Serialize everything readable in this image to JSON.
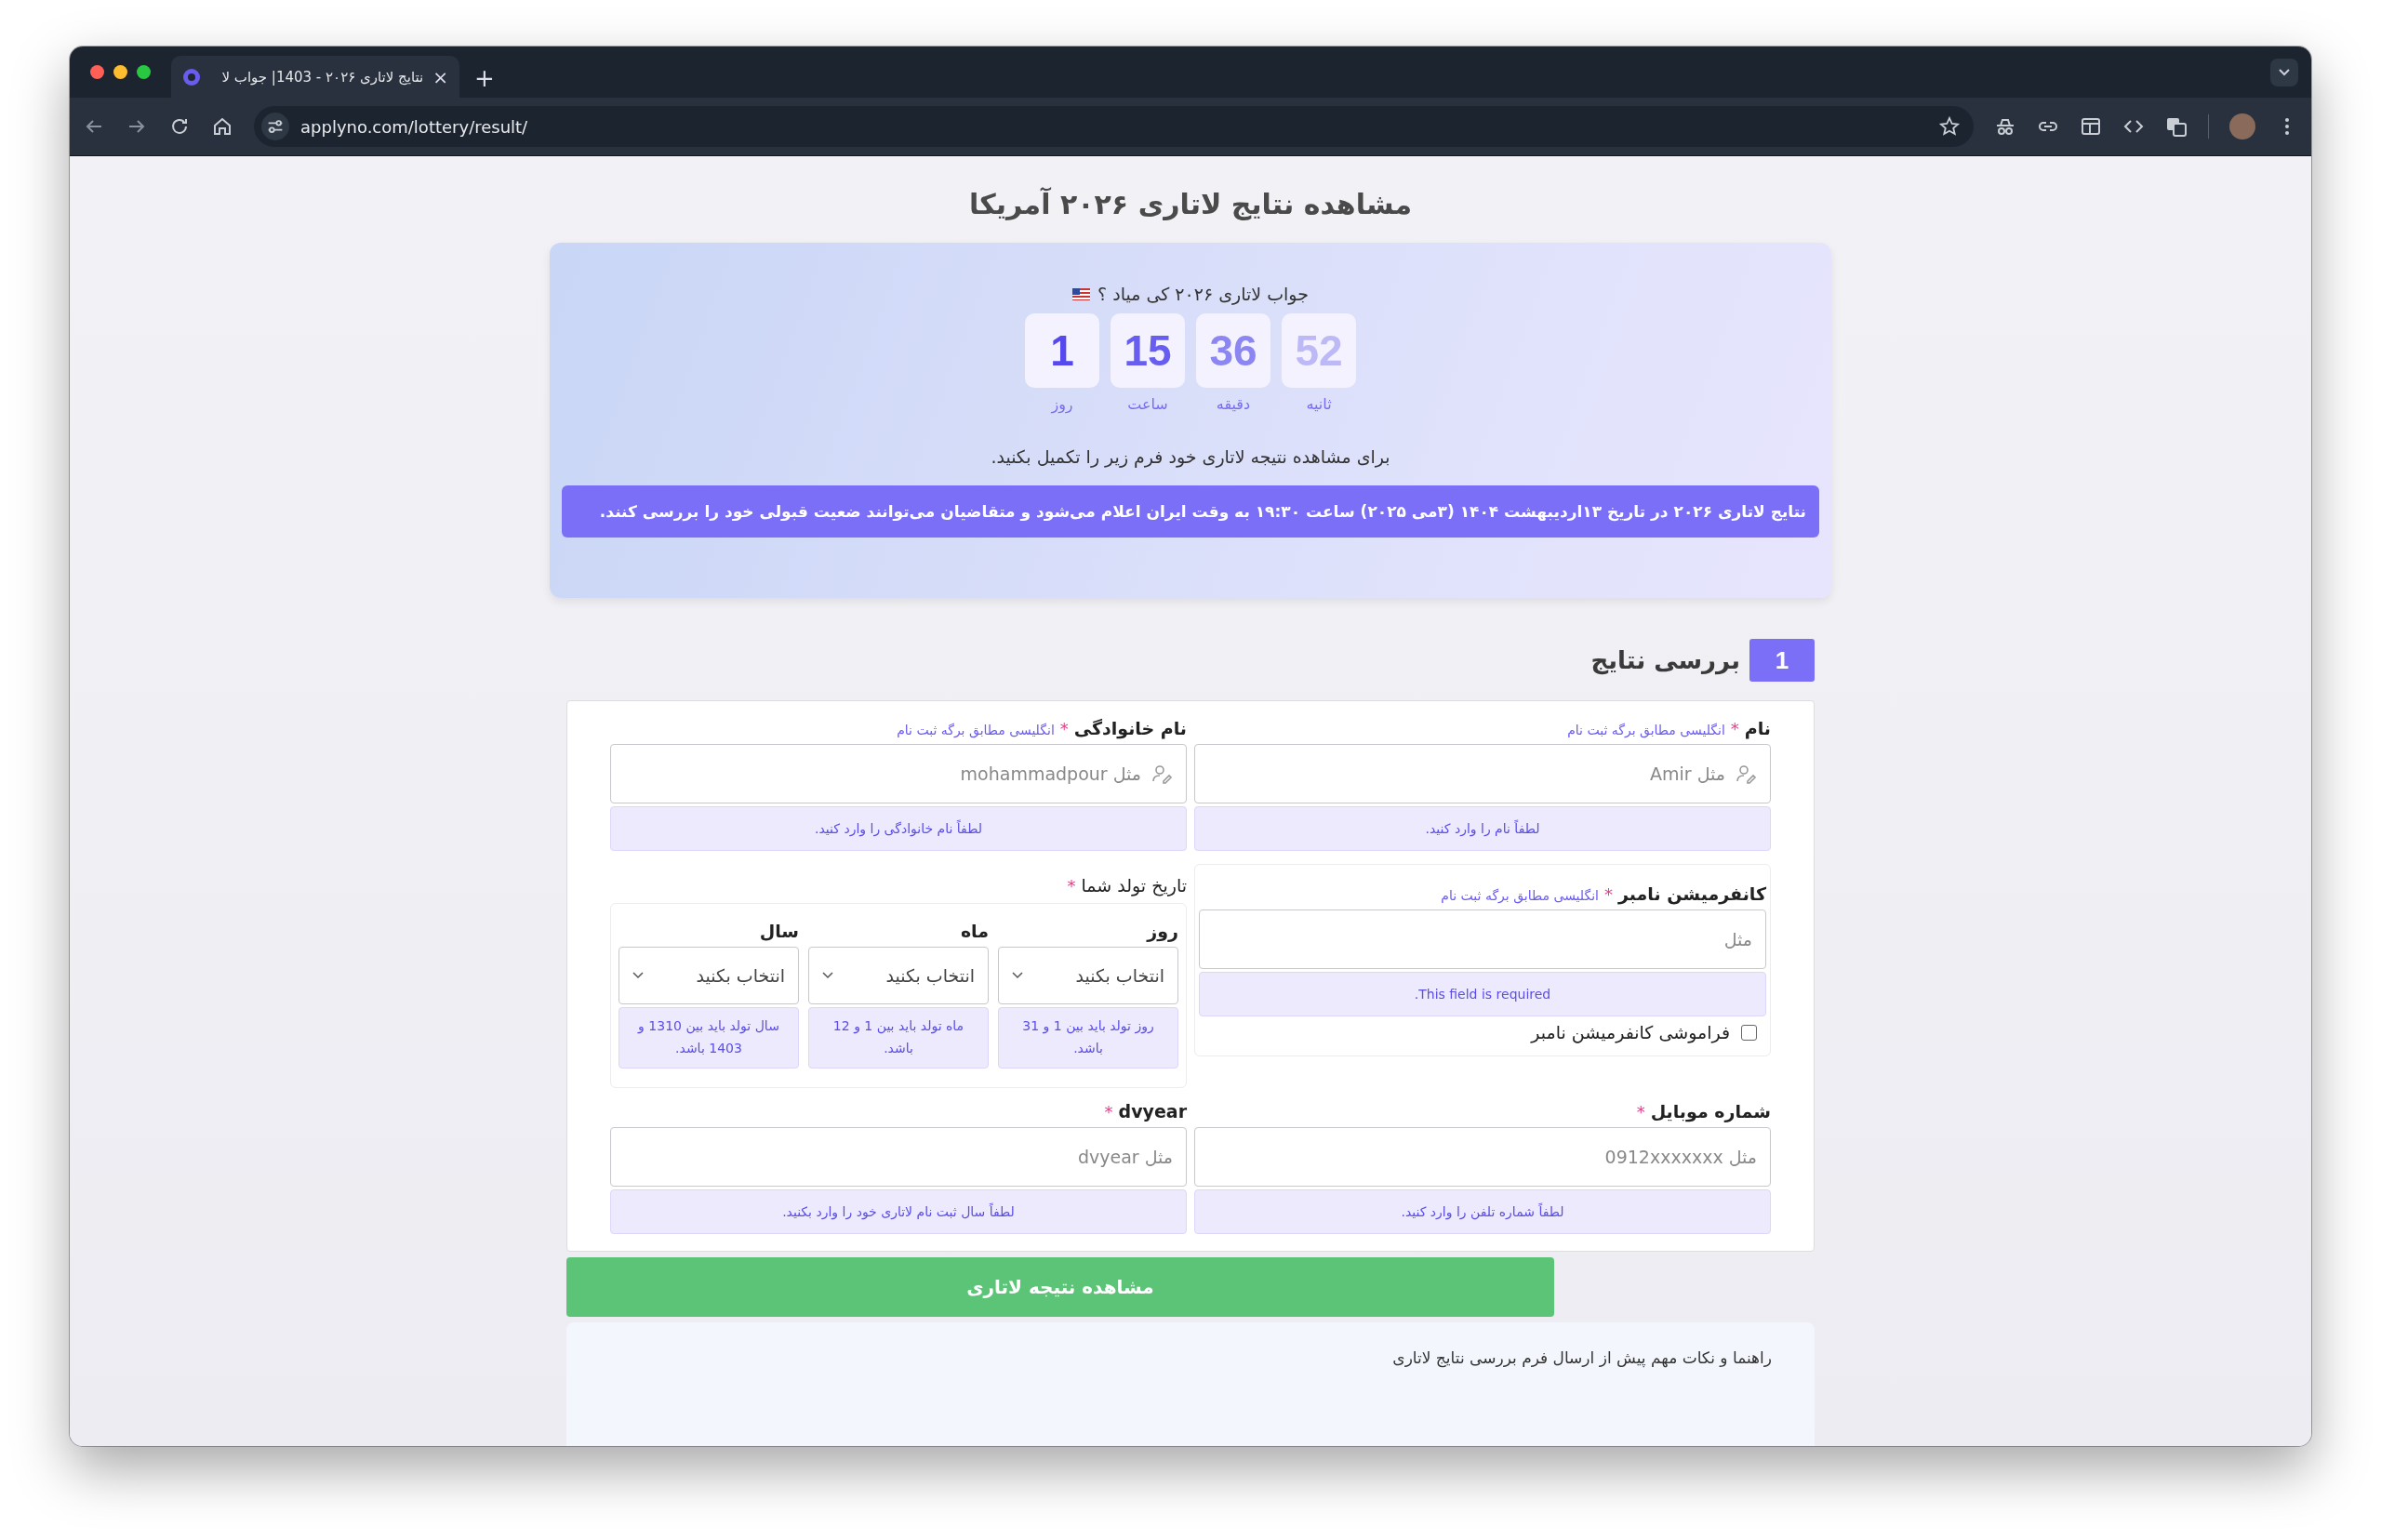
{
  "browser": {
    "tab_title": "نتایج لاتاری ۲۰۲۶ - 1403| جواب لا",
    "tab_close": "×",
    "new_tab": "+",
    "url": "applyno.com/lottery/result/"
  },
  "page": {
    "title": "مشاهده نتایج لاتاری ۲۰۲۶ آمریکا"
  },
  "countdown": {
    "question": "جواب لاتاری ۲۰۲۶ کی میاد ؟",
    "units": [
      {
        "value": "52",
        "label": "ثانیه",
        "color": "#bdb8f6"
      },
      {
        "value": "36",
        "label": "دقیقه",
        "color": "#8c86f2"
      },
      {
        "value": "15",
        "label": "ساعت",
        "color": "#675ef0"
      },
      {
        "value": "1",
        "label": "روز",
        "color": "#5448ee"
      }
    ],
    "instruction": "برای مشاهده نتیجه لاتاری خود فرم زیر را تکمیل بکنید.",
    "notice": "نتایج لاتاری ۲۰۲۶ در تاریخ ۱۳اردیبهشت ۱۴۰۴ (۳می ۲۰۲۵) ساعت ۱۹:۳۰ به وقت ایران اعلام می‌شود و متقاضیان می‌توانند ضعیت قبولی خود را بررسی کنند."
  },
  "section": {
    "number": "1",
    "title": "بررسی نتایج"
  },
  "form": {
    "fields": [
      {
        "kind": "person",
        "label": "نام",
        "required_mark": "*",
        "hint": "انگلیسی مطابق برگه ثبت نام",
        "placeholder": "مثل Amir",
        "error": "لطفاً نام را وارد کنید."
      },
      {
        "kind": "person",
        "label": "نام خانوادگی",
        "required_mark": "*",
        "hint": "انگلیسی مطابق برگه ثبت نام",
        "placeholder": "مثل mohammadpour",
        "error": "لطفاً نام خانوادگی را وارد کنید."
      },
      {
        "kind": "confirmation",
        "label": "کانفرمیشن نامبر",
        "required_mark": "*",
        "hint": "انگلیسی مطابق برگه ثبت نام",
        "placeholder": "مثل",
        "error": "This field is required.",
        "checkbox": {
          "label": "فراموشی کانفرمیشن نامبر",
          "checked": false
        }
      },
      {
        "kind": "date",
        "label": "تاریخ تولد شما",
        "required_mark": "*",
        "parts": [
          {
            "label": "روز",
            "value": "انتخاب بکنید",
            "error": "روز تولد باید بین 1 و 31 باشد."
          },
          {
            "label": "ماه",
            "value": "انتخاب بکنید",
            "error": "ماه تولد باید بین 1 و 12 باشد."
          },
          {
            "label": "سال",
            "value": "انتخاب بکنید",
            "error": "سال تولد باید بین 1310 و 1403 باشد."
          }
        ]
      },
      {
        "kind": "text",
        "label": "شماره موبایل",
        "required_mark": "*",
        "placeholder": "مثل 0912xxxxxxx",
        "error": "لطفاً شماره تلفن را وارد کنید."
      },
      {
        "kind": "text",
        "label": "dvyear",
        "required_mark": "*",
        "placeholder": "مثل dvyear",
        "error": "لطفاً سال ثبت نام لاتاری خود را وارد بکنید."
      }
    ]
  },
  "submit": "مشاهده نتیجه لاتاری",
  "guide": {
    "title": "راهنما و نکات مهم پیش از ارسال فرم بررسی نتایج لاتاری"
  }
}
